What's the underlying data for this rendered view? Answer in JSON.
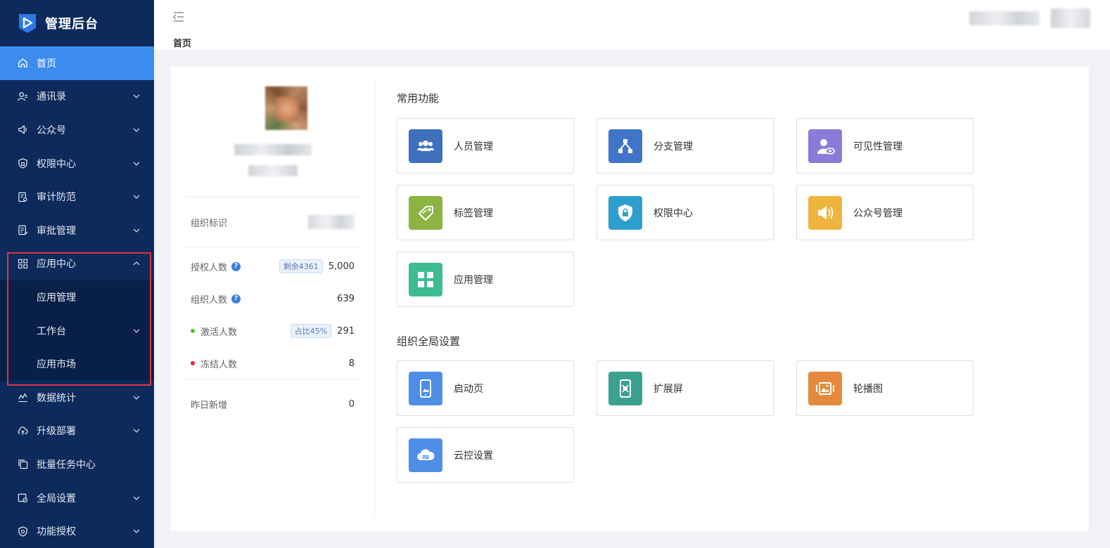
{
  "app": {
    "title": "管理后台"
  },
  "sidebar": {
    "items": [
      {
        "label": "首页",
        "icon": "home-icon",
        "active": true
      },
      {
        "label": "通讯录",
        "icon": "contacts-icon"
      },
      {
        "label": "公众号",
        "icon": "megaphone-icon"
      },
      {
        "label": "权限中心",
        "icon": "shield-icon"
      },
      {
        "label": "审计防范",
        "icon": "audit-icon"
      },
      {
        "label": "审批管理",
        "icon": "approval-icon"
      },
      {
        "label": "应用中心",
        "icon": "grid-icon",
        "expanded": true
      },
      {
        "label": "数据统计",
        "icon": "chart-icon"
      },
      {
        "label": "升级部署",
        "icon": "cloud-upload-icon"
      },
      {
        "label": "批量任务中心",
        "icon": "copy-icon"
      },
      {
        "label": "全局设置",
        "icon": "settings-icon"
      },
      {
        "label": "功能授权",
        "icon": "license-icon"
      }
    ],
    "app_center_sub": [
      {
        "label": "应用管理"
      },
      {
        "label": "工作台",
        "has_children": true
      },
      {
        "label": "应用市场"
      }
    ]
  },
  "header": {
    "breadcrumb": "首页"
  },
  "stats": {
    "org_id_label": "组织标识",
    "authorized_label": "授权人数",
    "authorized_badge": "剩余4361",
    "authorized_value": "5,000",
    "org_members_label": "组织人数",
    "org_members_value": "639",
    "activated_label": "激活人数",
    "activated_badge": "占比45%",
    "activated_value": "291",
    "frozen_label": "冻结人数",
    "frozen_value": "8",
    "yesterday_label": "昨日新增",
    "yesterday_value": "0"
  },
  "common_functions": {
    "title": "常用功能",
    "cards": [
      {
        "label": "人员管理",
        "icon": "people-icon",
        "color": "#3f6fbf"
      },
      {
        "label": "分支管理",
        "icon": "branch-icon",
        "color": "#3f75c9"
      },
      {
        "label": "可见性管理",
        "icon": "user-visibility-icon",
        "color": "#8b7bd8"
      },
      {
        "label": "标签管理",
        "icon": "tag-icon",
        "color": "#8db443"
      },
      {
        "label": "权限中心",
        "icon": "shield-lock-icon",
        "color": "#2d9fcf"
      },
      {
        "label": "公众号管理",
        "icon": "speaker-icon",
        "color": "#efb43e"
      },
      {
        "label": "应用管理",
        "icon": "apps-icon",
        "color": "#3dbd8f"
      }
    ]
  },
  "org_settings": {
    "title": "组织全局设置",
    "cards": [
      {
        "label": "启动页",
        "icon": "splash-phone-icon",
        "color": "#4d8fe6"
      },
      {
        "label": "扩展屏",
        "icon": "extend-screen-icon",
        "color": "#3aa090"
      },
      {
        "label": "轮播图",
        "icon": "carousel-image-icon",
        "color": "#e58a3d"
      },
      {
        "label": "云控设置",
        "icon": "cloud-control-icon",
        "color": "#4d8fe6"
      }
    ]
  }
}
